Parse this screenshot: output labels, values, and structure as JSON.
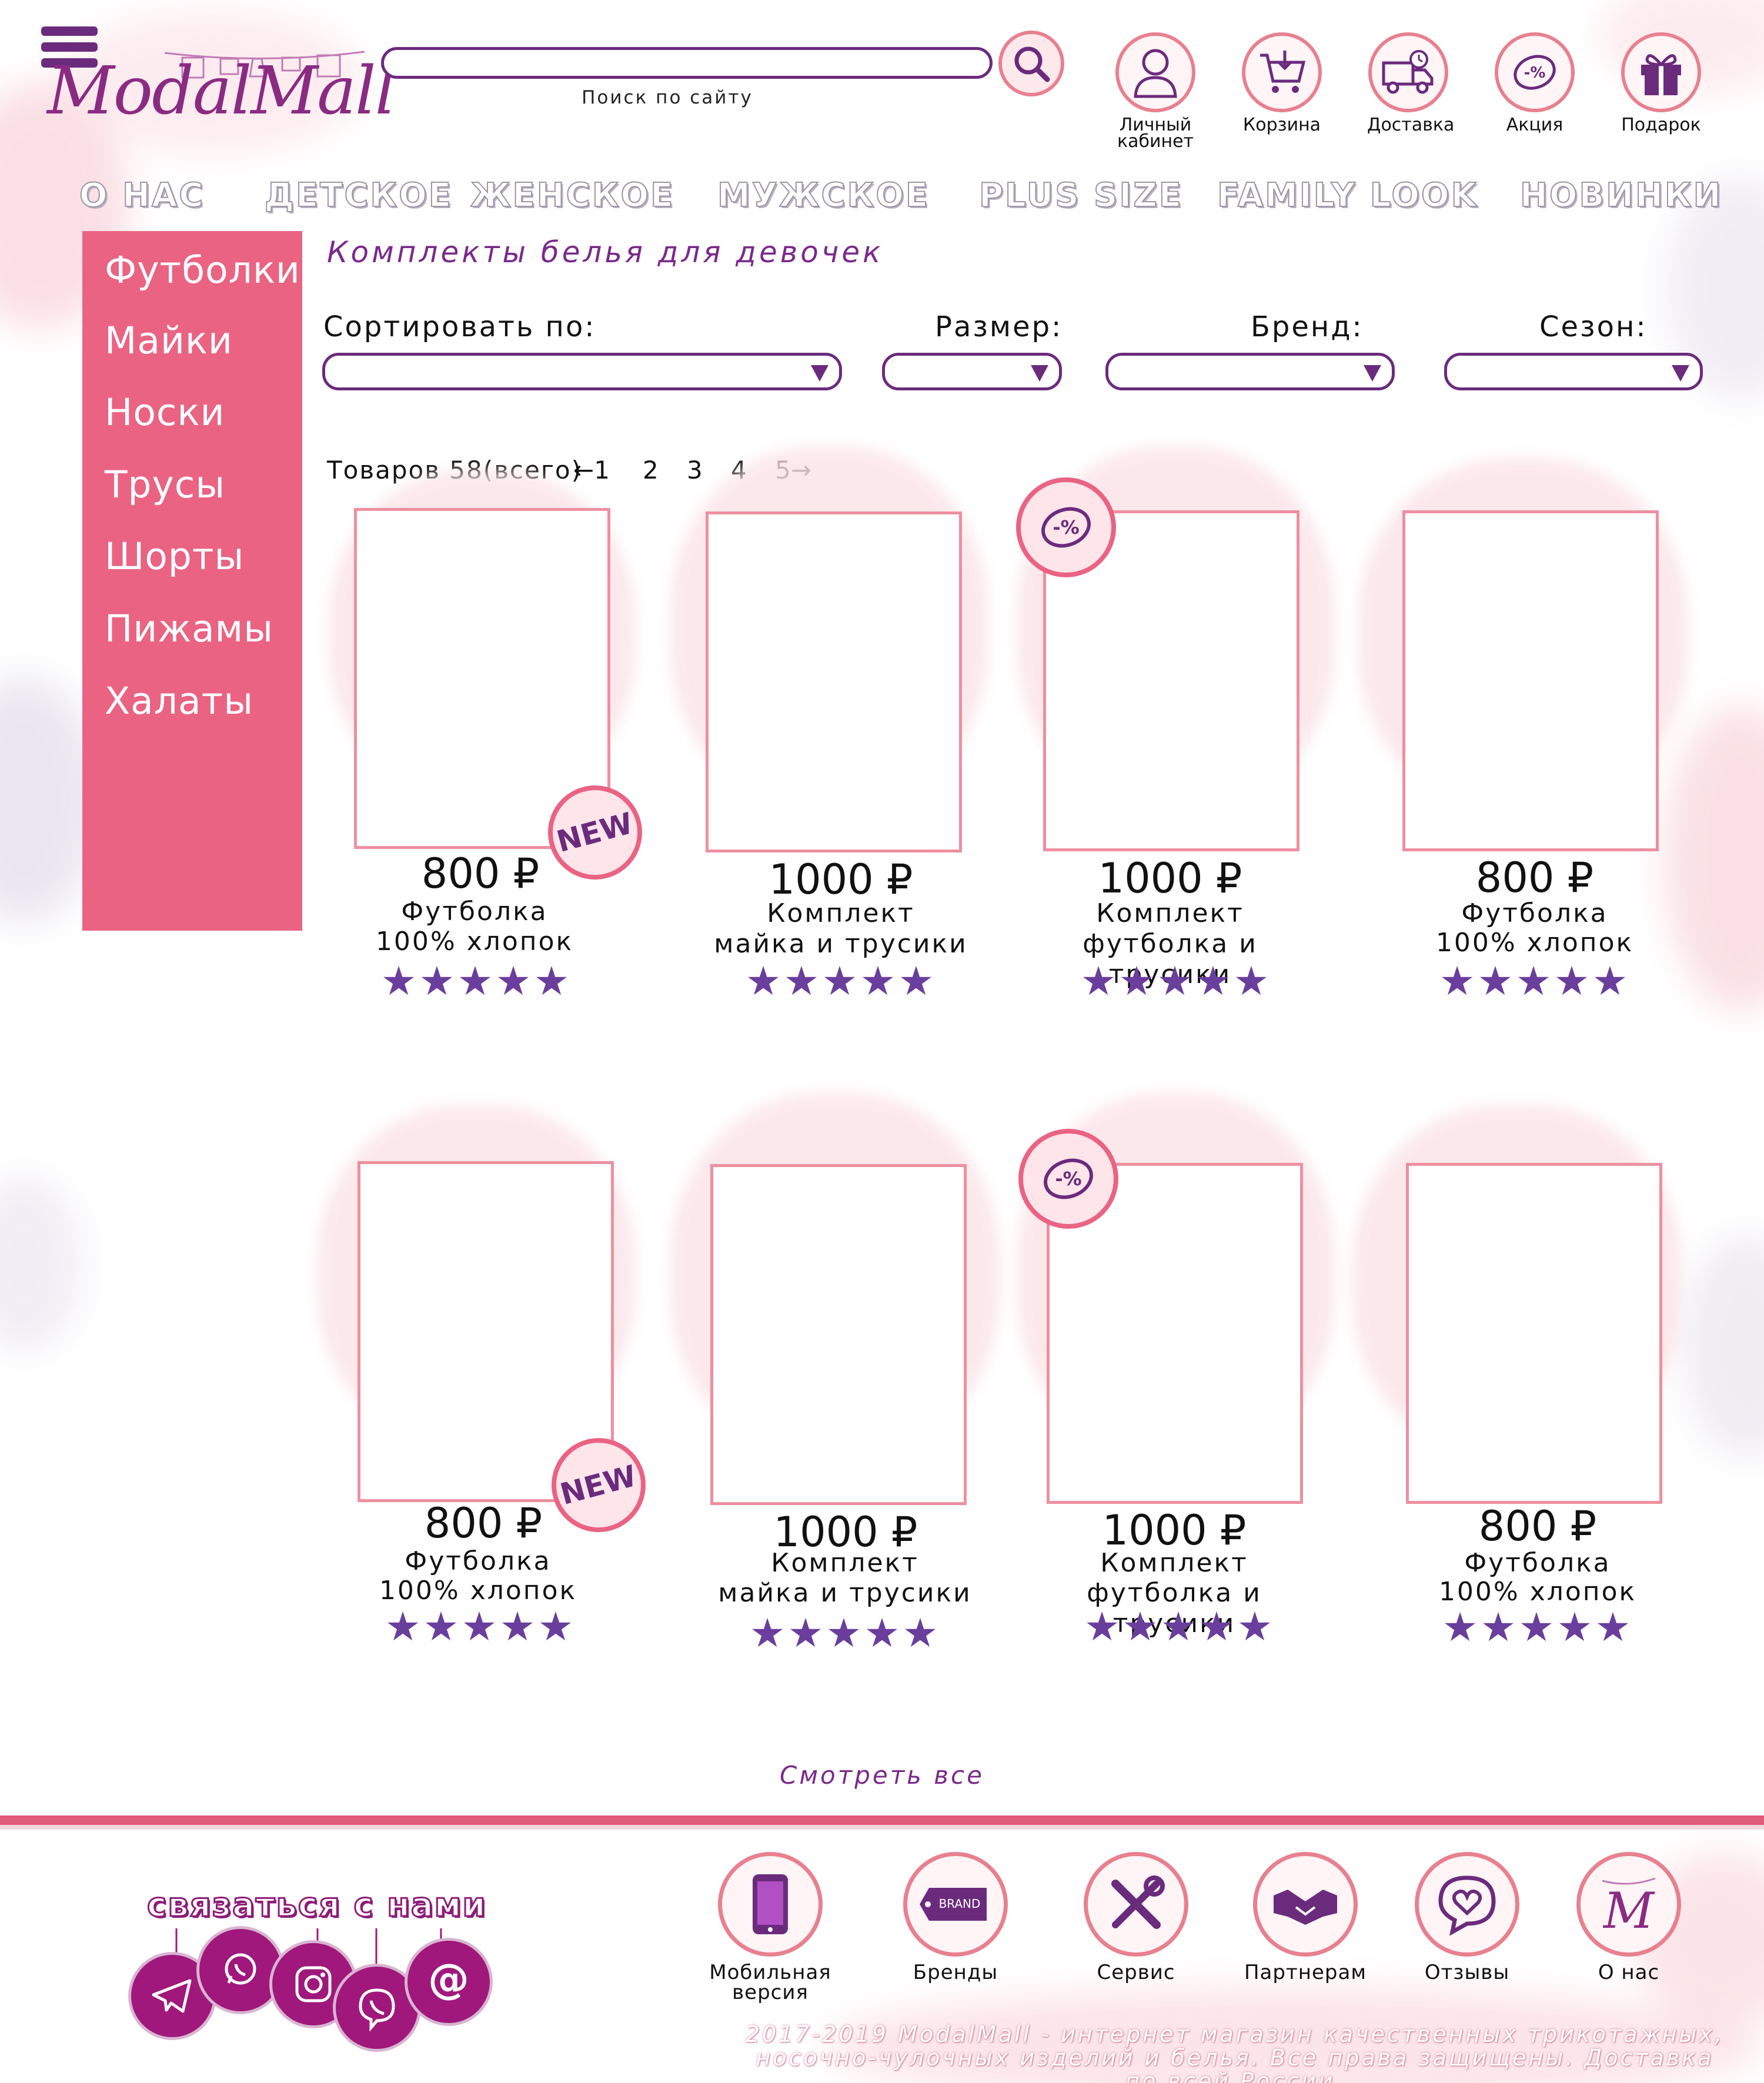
{
  "header": {
    "logo_text": "ModalMall",
    "search": {
      "hint": "Поиск по сайту",
      "value": ""
    },
    "icons": [
      {
        "id": "account",
        "label": "Личный кабинет",
        "icon": "person-icon"
      },
      {
        "id": "cart",
        "label": "Корзина",
        "icon": "cart-icon"
      },
      {
        "id": "delivery",
        "label": "Доставка",
        "icon": "truck-icon"
      },
      {
        "id": "promo",
        "label": "Акция",
        "icon": "percent-tag-icon"
      },
      {
        "id": "gift",
        "label": "Подарок",
        "icon": "gift-icon"
      }
    ]
  },
  "main_nav": [
    "О НАС",
    "ДЕТСКОЕ",
    "ЖЕНСКОЕ",
    "МУЖСКОЕ",
    "PLUS SIZE",
    "FAMILY LOOK",
    "НОВИНКИ"
  ],
  "sidebar": [
    "Футболки",
    "Майки",
    "Носки",
    "Трусы",
    "Шорты",
    "Пижамы",
    "Халаты"
  ],
  "content": {
    "breadcrumb": "Комплекты белья для девочек",
    "filters": {
      "sort_label": "Сортировать по:",
      "size_label": "Размер:",
      "brand_label": "Бренд:",
      "season_label": "Сезон:"
    },
    "count_label": "Товаров 58(всего)",
    "pager": {
      "prev": "←1",
      "pages": [
        "2",
        "3",
        "4"
      ],
      "next": "5→"
    },
    "view_all": "Смотреть все"
  },
  "products": [
    {
      "price": "800 ₽",
      "name1": "Футболка",
      "name2": "100% хлопок",
      "rating": 5,
      "badge": "NEW"
    },
    {
      "price": "1000 ₽",
      "name1": "Комплект",
      "name2": "майка и трусики",
      "rating": 5,
      "badge": ""
    },
    {
      "price": "1000 ₽",
      "name1": "Комплект",
      "name2": "футболка и трусики",
      "rating": 5,
      "badge": "-%"
    },
    {
      "price": "800 ₽",
      "name1": "Футболка",
      "name2": "100% хлопок",
      "rating": 5,
      "badge": ""
    },
    {
      "price": "800 ₽",
      "name1": "Футболка",
      "name2": "100% хлопок",
      "rating": 5,
      "badge": "NEW"
    },
    {
      "price": "1000 ₽",
      "name1": "Комплект",
      "name2": "майка и трусики",
      "rating": 5,
      "badge": ""
    },
    {
      "price": "1000 ₽",
      "name1": "Комплект",
      "name2": "футболка и трусики",
      "rating": 5,
      "badge": "-%"
    },
    {
      "price": "800 ₽",
      "name1": "Футболка",
      "name2": "100% хлопок",
      "rating": 5,
      "badge": ""
    }
  ],
  "stars_text": "★★★★★",
  "footer": {
    "contact_title": "связаться с нами",
    "socials": [
      "telegram-icon",
      "whatsapp-icon",
      "instagram-icon",
      "viber-icon",
      "email-icon"
    ],
    "links": [
      {
        "label": "Мобильная версия",
        "icon": "phone-icon"
      },
      {
        "label": "Бренды",
        "icon": "brand-tag-icon",
        "icon_text": "BRAND"
      },
      {
        "label": "Сервис",
        "icon": "tools-icon"
      },
      {
        "label": "Партнерам",
        "icon": "handshake-icon"
      },
      {
        "label": "Отзывы",
        "icon": "heart-chat-icon"
      },
      {
        "label": "О нас",
        "icon": "logo-m-icon",
        "icon_text": "M"
      }
    ],
    "copyright_line1": "2017-2019 ModalMall - интернет магазин качественных трикотажных,",
    "copyright_line2": "носочно-чулочных изделий и белья. Все права защищены. Доставка по всей России."
  },
  "colors": {
    "purple": "#6b2b7d",
    "pink": "#ea6383",
    "star": "#6a3e9c"
  }
}
